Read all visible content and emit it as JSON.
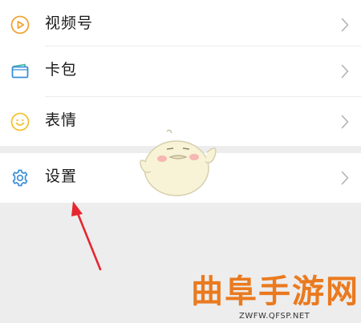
{
  "menu": {
    "items": [
      {
        "label": "视频号",
        "icon": "channels-icon"
      },
      {
        "label": "卡包",
        "icon": "card-wallet-icon"
      },
      {
        "label": "表情",
        "icon": "sticker-smile-icon"
      },
      {
        "label": "设置",
        "icon": "settings-gear-icon"
      }
    ]
  },
  "colors": {
    "background": "#ededed",
    "card": "#ffffff",
    "channels_icon": "#f0a437",
    "card_icon": "#3a8fd9",
    "sticker_icon": "#f2c230",
    "settings_icon": "#3a8fd9",
    "arrow": "#e5272f",
    "watermark": "#ea7a1f"
  },
  "watermark": {
    "title": "曲阜手游网",
    "url": "ZWFW.QFSP.NET"
  }
}
